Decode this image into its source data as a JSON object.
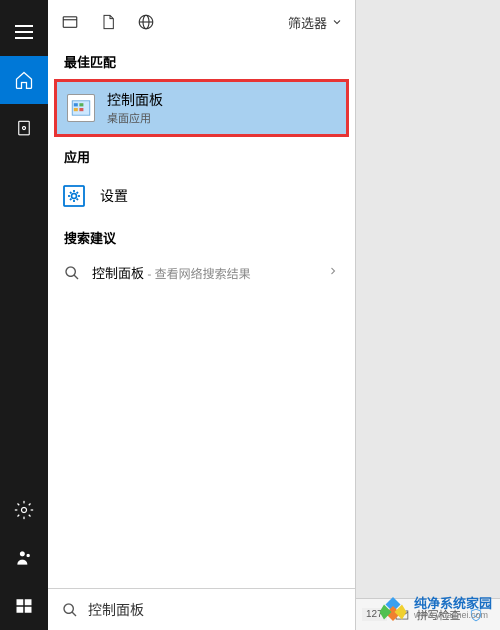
{
  "sidebar": {
    "items": [
      "hamburger",
      "home",
      "document",
      "settings",
      "people",
      "start"
    ]
  },
  "topbar": {
    "filter_label": "筛选器"
  },
  "sections": {
    "best_match": "最佳匹配",
    "apps": "应用",
    "suggestions": "搜索建议"
  },
  "results": {
    "control_panel": {
      "title": "控制面板",
      "subtitle": "桌面应用"
    },
    "settings": {
      "title": "设置"
    }
  },
  "suggestion": {
    "text": "控制面板",
    "extra": " - 查看网络搜索结果"
  },
  "search": {
    "value": "控制面板"
  },
  "status": {
    "count": "127",
    "check_label": "拼写检查"
  },
  "watermark": {
    "title": "纯净系统家园",
    "url": "www.yidaimei.com"
  }
}
